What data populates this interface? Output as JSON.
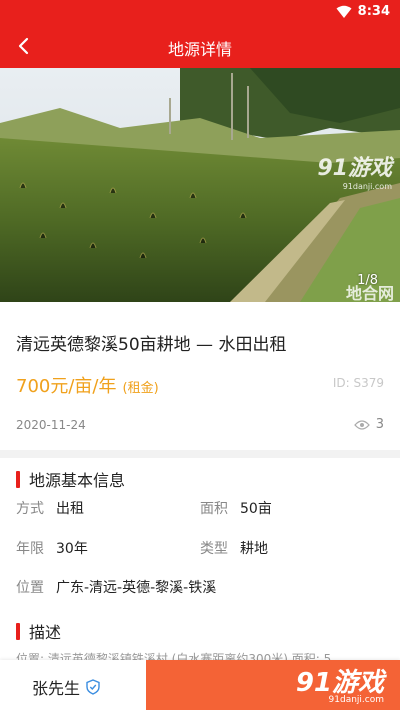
{
  "status_bar": {
    "time": "8:34"
  },
  "app_bar": {
    "title": "地源详情"
  },
  "gallery": {
    "counter": "1/8",
    "watermark": "91游戏",
    "watermark_sub": "91danji.com",
    "watermark2": "地合网"
  },
  "listing": {
    "title": "清远英德黎溪50亩耕地 — 水田出租",
    "price": "700元/亩/年",
    "price_tag": "(租金)",
    "id": "ID: S379",
    "date": "2020-11-24",
    "views": "3"
  },
  "basic_info": {
    "heading": "地源基本信息",
    "fields": [
      {
        "key": "方式",
        "value": "出租"
      },
      {
        "key": "面积",
        "value": "50亩"
      },
      {
        "key": "年限",
        "value": "30年"
      },
      {
        "key": "类型",
        "value": "耕地"
      },
      {
        "key": "位置",
        "value": "广东-清远-英德-黎溪-铁溪"
      }
    ]
  },
  "description": {
    "heading": "描述",
    "text": "位置: 清远英德黎溪镇铁溪村 (白水寨距离约300米) 面积: 5"
  },
  "bottom_bar": {
    "contact_name": "张先生",
    "logo": "91游戏",
    "logo_sub": "91danji.com"
  },
  "colors": {
    "brand_red": "#e8201c",
    "price_orange": "#f0a11c",
    "call_orange": "#f46336"
  }
}
